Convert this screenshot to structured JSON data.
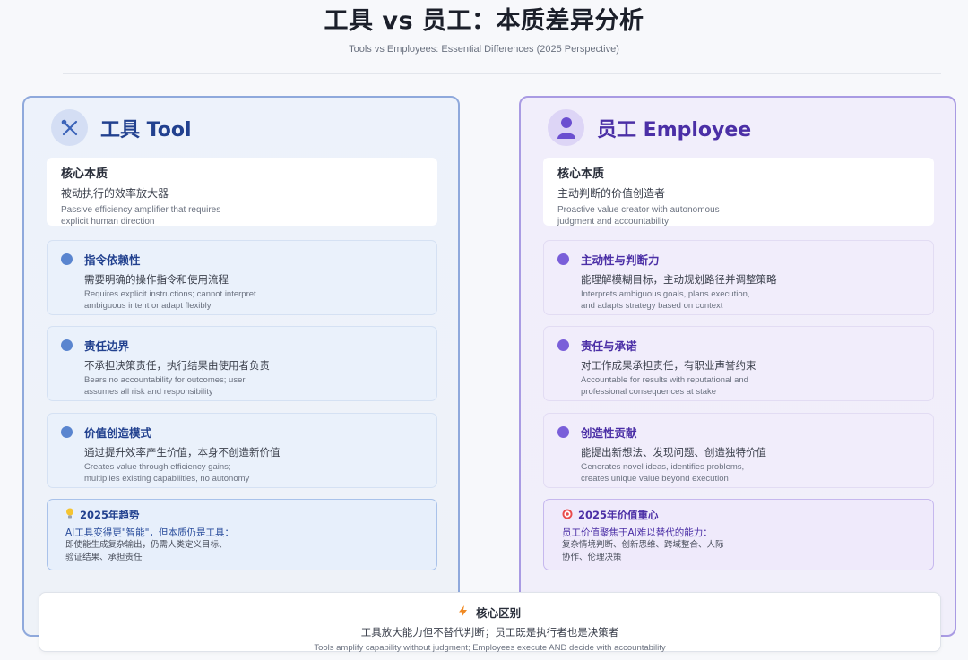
{
  "header": {
    "title": "工具 vs 员工：本质差异分析",
    "subtitle": "Tools vs Employees: Essential Differences (2025 Perspective)"
  },
  "tool": {
    "title": "工具 Tool",
    "icon": "tools-icon",
    "accent": "#22418f",
    "core": {
      "label": "核心本质",
      "cn": "被动执行的效率放大器",
      "en": "Passive efficiency amplifier that requires explicit human direction"
    },
    "features": [
      {
        "title": "指令依赖性",
        "cn": "需要明确的操作指令和使用流程",
        "en": "Requires explicit instructions; cannot interpret ambiguous intent or adapt flexibly"
      },
      {
        "title": "责任边界",
        "cn": "不承担决策责任，执行结果由使用者负责",
        "en": "Bears no accountability for outcomes; user assumes all risk and responsibility"
      },
      {
        "title": "价值创造模式",
        "cn": "通过提升效率产生价值，本身不创造新价值",
        "en": "Creates value through efficiency gains; multiplies existing capabilities, no autonomy"
      }
    ],
    "trend": {
      "icon": "lightbulb-icon",
      "title": "2025年趋势",
      "text": "AI工具变得更\"智能\"，但本质仍是工具：",
      "detail": "即使能生成复杂输出，仍需人类定义目标、验证结果、承担责任"
    }
  },
  "employee": {
    "title": "员工 Employee",
    "icon": "person-icon",
    "accent": "#4b2fa6",
    "core": {
      "label": "核心本质",
      "cn": "主动判断的价值创造者",
      "en": "Proactive value creator with autonomous judgment and accountability"
    },
    "features": [
      {
        "title": "主动性与判断力",
        "cn": "能理解模糊目标，主动规划路径并调整策略",
        "en": "Interprets ambiguous goals, plans execution, and adapts strategy based on context"
      },
      {
        "title": "责任与承诺",
        "cn": "对工作成果承担责任，有职业声誉约束",
        "en": "Accountable for results with reputational and professional consequences at stake"
      },
      {
        "title": "创造性贡献",
        "cn": "能提出新想法、发现问题、创造独特价值",
        "en": "Generates novel ideas, identifies problems, creates unique value beyond execution"
      }
    ],
    "trend": {
      "icon": "target-icon",
      "title": "2025年价值重心",
      "text": "员工价值聚焦于AI难以替代的能力：",
      "detail": "复杂情境判断、创新思维、跨域整合、人际协作、伦理决策"
    }
  },
  "bottom": {
    "icon": "lightning-icon",
    "title": "核心区别",
    "cn": "工具放大能力但不替代判断；员工既是执行者也是决策者",
    "en": "Tools amplify capability without judgment; Employees execute AND decide with accountability"
  }
}
